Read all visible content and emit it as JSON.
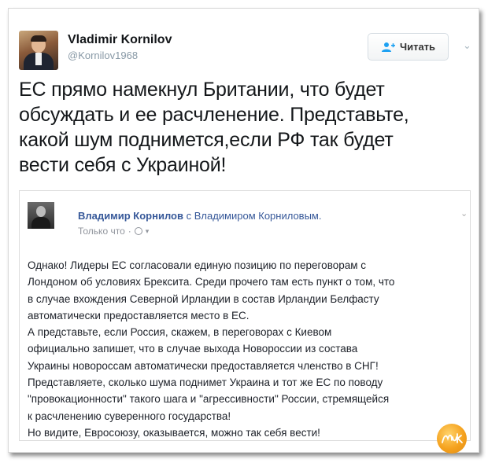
{
  "tweet": {
    "author_name": "Vladimir Kornilov",
    "author_handle": "@Kornilov1968",
    "follow_label": "Читать",
    "text_lines": [
      "ЕС прямо намекнул Британии, что будет",
      "обсуждать и ее расчленение. Представьте,",
      "какой шум поднимется,если РФ так будет",
      "вести себя с Украиной!"
    ]
  },
  "embed": {
    "author_name": "Владимир Корнилов",
    "with_text": "с Владимиром Корниловым.",
    "meta": "Только что",
    "body_lines": [
      "Однако! Лидеры ЕС согласовали единую позицию по переговорам с",
      "Лондоном об условиях Брексита. Среди прочего там есть пункт о том, что",
      "в случае вхождения Северной Ирландии в состав Ирландии Белфасту",
      "автоматически предоставляется место в ЕС.",
      "А представьте, если Россия, скажем, в переговорах с Киевом",
      "официально запишет, что в случае выхода Новороссии из состава",
      "Украины новороссам автоматически предоставляется членство в СНГ!",
      "Представляете, сколько шума поднимет Украина и тот же ЕС по поводу",
      "\"провокационности\" такого шага и \"агрессивности\" России, стремящейся",
      "к расчленению суверенного государства!",
      "Но видите, Евросоюзу, оказывается, можно так себя вести!"
    ]
  },
  "icons": {
    "follow": "user-plus-icon",
    "caret": "chevron-down-icon",
    "audience": "globe-icon",
    "watermark": "site-logo"
  },
  "colors": {
    "fb_link": "#365899",
    "twitter_handle": "#8899a6",
    "follow_icon": "#1da1f2",
    "logo": "#f5a21f"
  }
}
